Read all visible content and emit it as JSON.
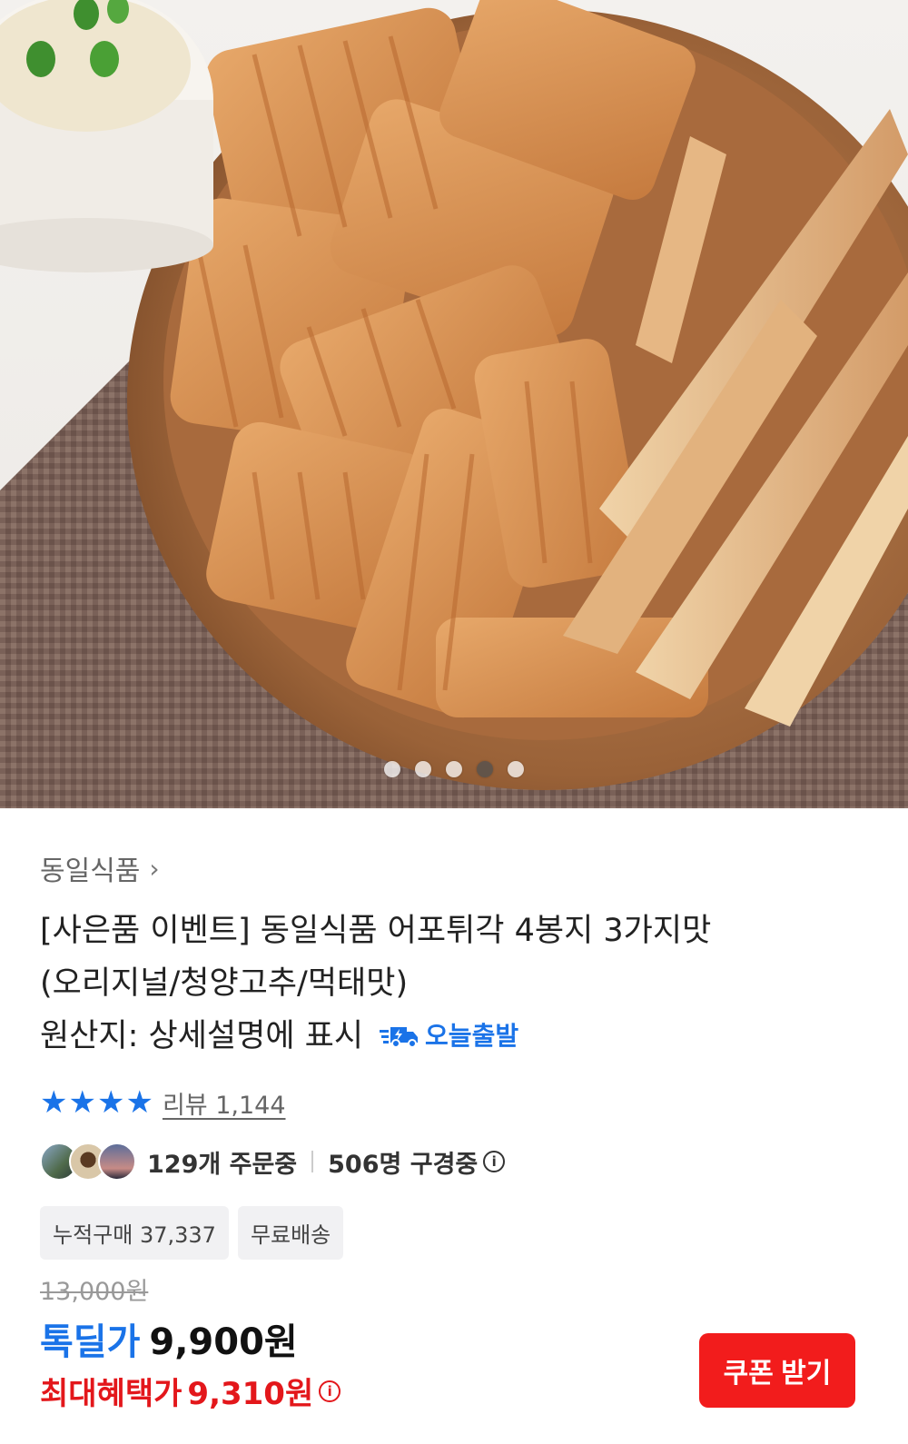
{
  "product_image": {
    "icon": "snack-photo",
    "slides": [
      false,
      false,
      false,
      true,
      false
    ]
  },
  "brand": {
    "name": "동일식품",
    "chevron": "›"
  },
  "title": {
    "line1": "[사은품 이벤트] 동일식품 어포튀각 4봉지 3가지맛",
    "line2": "(오리지널/청양고추/먹태맛)",
    "line3": "원산지: 상세설명에 표시"
  },
  "badge": {
    "label": "오늘출발",
    "icon": "fast-truck-icon",
    "color": "#1a73e8"
  },
  "rating": {
    "stars": 4,
    "review_label": "리뷰 1,144"
  },
  "social": {
    "orders": "129개 주문중",
    "viewers": "506명 구경중",
    "info": "i"
  },
  "tags": [
    "누적구매 37,337",
    "무료배송"
  ],
  "price": {
    "original": "13,000원",
    "deal_label": "톡딜가",
    "deal_price": "9,900원",
    "max_label": "최대혜택가",
    "max_price": "9,310원",
    "info": "i"
  },
  "coupon_button": "쿠폰 받기",
  "colors": {
    "accent": "#1a73e8",
    "sale": "#e3171b",
    "button": "#f21c1c"
  }
}
